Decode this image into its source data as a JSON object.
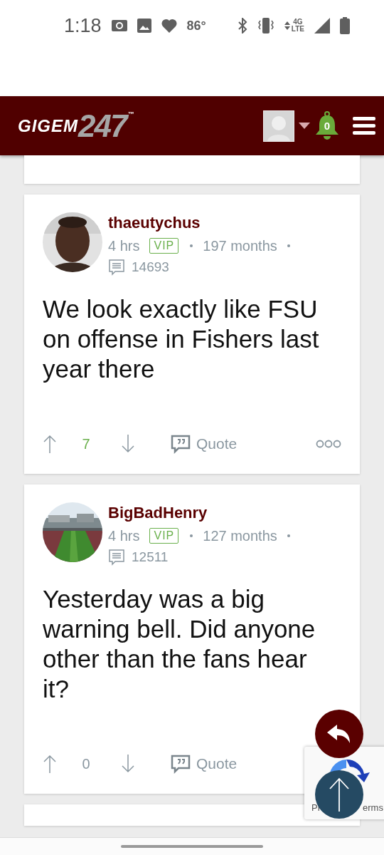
{
  "status_bar": {
    "time": "1:18",
    "temperature": "86°",
    "network": "4G",
    "network_sub": "LTE"
  },
  "header": {
    "logo_word": "GIGEM",
    "logo_number": "247",
    "trademark": "™",
    "notification_count": "0"
  },
  "posts": [
    {
      "author": "thaeutychus",
      "time": "4 hrs",
      "badge": "VIP",
      "tenure": "197 months",
      "post_count": "14693",
      "body": "We look exactly like FSU on offense in Fishers last year there",
      "score": "7",
      "positive": true,
      "quote_label": "Quote",
      "show_more": true
    },
    {
      "author": "BigBadHenry",
      "time": "4 hrs",
      "badge": "VIP",
      "tenure": "127 months",
      "post_count": "12511",
      "body": "Yesterday was a big warning bell. Did anyone other than the fans hear it?",
      "score": "0",
      "positive": false,
      "quote_label": "Quote",
      "show_more": false
    }
  ],
  "recaptcha": {
    "left_text": "Pr",
    "right_text": "erms"
  }
}
